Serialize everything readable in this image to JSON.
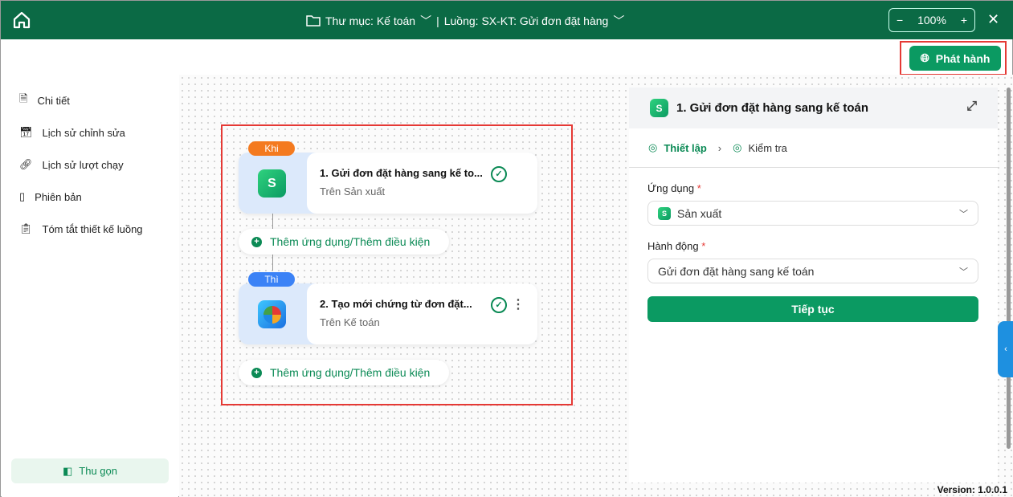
{
  "header": {
    "folder": "Thư mục: Kế toán",
    "flow": "Luồng: SX-KT: Gửi đơn đặt hàng",
    "zoom": "100%"
  },
  "publish": "Phát hành",
  "sidebar": {
    "items": [
      {
        "label": "Chi tiết"
      },
      {
        "label": "Lịch sử chỉnh sửa"
      },
      {
        "label": "Lịch sử lượt chạy"
      },
      {
        "label": "Phiên bản"
      },
      {
        "label": "Tóm tắt thiết kế luồng"
      }
    ],
    "collapse": "Thu gọn"
  },
  "nodes": [
    {
      "tag": "Khi",
      "title": "1.  Gửi đơn đặt hàng sang kế to...",
      "sub": "Trên Sản xuất"
    },
    {
      "tag": "Thì",
      "title": "2.  Tạo mới chứng từ đơn đặt...",
      "sub": "Trên Kế toán"
    }
  ],
  "add_label": "Thêm ứng dụng/Thêm điều kiện",
  "panel": {
    "title": "1. Gửi đơn đặt hàng sang kế toán",
    "step1": "Thiết lập",
    "step2": "Kiểm tra",
    "app_label": "Ứng dụng",
    "app_value": "Sản xuất",
    "action_label": "Hành động",
    "action_value": "Gửi đơn đặt hàng sang kế toán",
    "required": "*",
    "continue": "Tiếp tục"
  },
  "version": "Version: 1.0.0.1"
}
